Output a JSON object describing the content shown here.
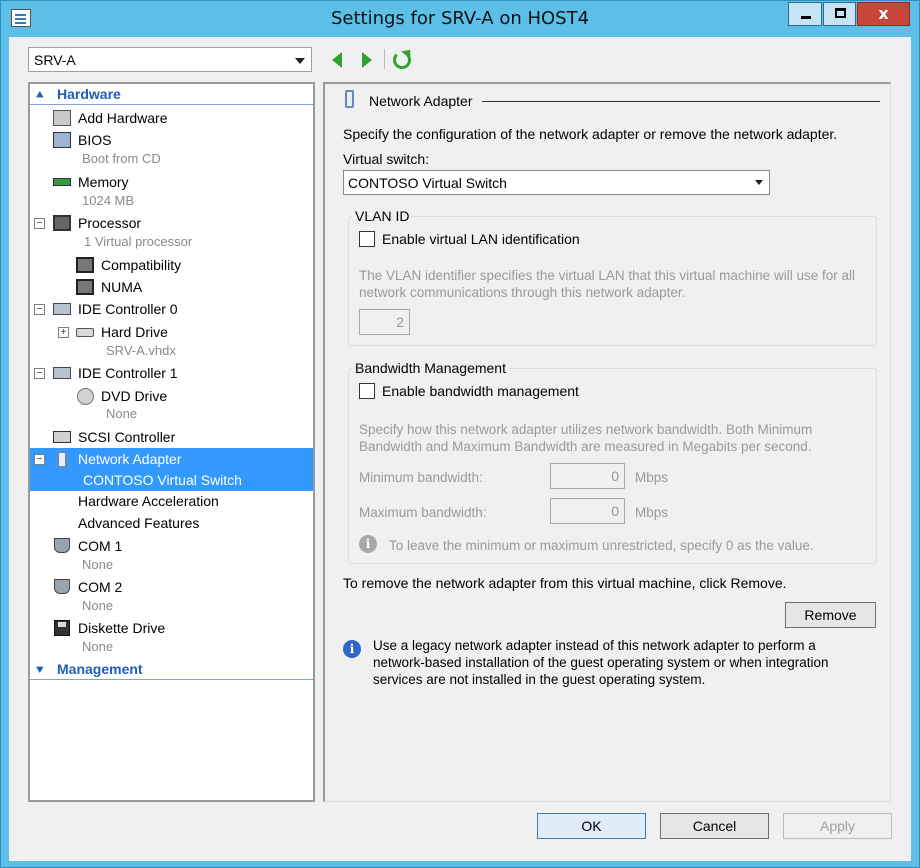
{
  "window": {
    "title": "Settings for SRV-A on HOST4",
    "close_glyph": "x"
  },
  "vm_selector": {
    "value": "SRV-A"
  },
  "tree": {
    "hardware_header": "Hardware",
    "management_header": "Management",
    "items": {
      "add_hardware": "Add Hardware",
      "bios": "BIOS",
      "bios_sub": "Boot from CD",
      "memory": "Memory",
      "memory_sub": "1024 MB",
      "processor": "Processor",
      "processor_sub": "1 Virtual processor",
      "compatibility": "Compatibility",
      "numa": "NUMA",
      "ide0": "IDE Controller 0",
      "hard_drive": "Hard Drive",
      "hard_drive_sub": "SRV-A.vhdx",
      "ide1": "IDE Controller 1",
      "dvd_drive": "DVD Drive",
      "dvd_drive_sub": "None",
      "scsi": "SCSI Controller",
      "network_adapter": "Network Adapter",
      "network_adapter_sub": "CONTOSO Virtual Switch",
      "hw_accel": "Hardware Acceleration",
      "adv_features": "Advanced Features",
      "com1": "COM 1",
      "com1_sub": "None",
      "com2": "COM 2",
      "com2_sub": "None",
      "diskette": "Diskette Drive",
      "diskette_sub": "None"
    }
  },
  "panel": {
    "title": "Network Adapter",
    "intro": "Specify the configuration of the network adapter or remove the network adapter.",
    "vswitch_label": "Virtual switch:",
    "vswitch_value": "CONTOSO Virtual Switch",
    "vlan": {
      "group_title": "VLAN ID",
      "checkbox_label": "Enable virtual LAN identification",
      "checked": false,
      "desc_line1": "The VLAN identifier specifies the virtual LAN that this virtual machine will use for all",
      "desc_line2": "network communications through this network adapter.",
      "value": "2"
    },
    "bandwidth": {
      "group_title": "Bandwidth Management",
      "checkbox_label": "Enable bandwidth management",
      "checked": false,
      "desc_line1": "Specify how this network adapter utilizes network bandwidth. Both Minimum",
      "desc_line2": "Bandwidth and Maximum Bandwidth are measured in Megabits per second.",
      "min_label": "Minimum bandwidth:",
      "min_value": "0",
      "max_label": "Maximum bandwidth:",
      "max_value": "0",
      "unit": "Mbps",
      "hint": "To leave the minimum or maximum unrestricted, specify 0 as the value."
    },
    "remove_text": "To remove the network adapter from this virtual machine, click Remove.",
    "remove_button": "Remove",
    "legacy_info": "Use a legacy network adapter instead of this network adapter to perform a network-based installation of the guest operating system or when integration services are not installed in the guest operating system."
  },
  "footer": {
    "ok": "OK",
    "cancel": "Cancel",
    "apply": "Apply"
  },
  "colors": {
    "titlebar": "#5bbfe8",
    "selection": "#3399ff",
    "section_header": "#1f5fb8",
    "nav_arrows": "#2fa52f",
    "close_button": "#c7473b"
  }
}
